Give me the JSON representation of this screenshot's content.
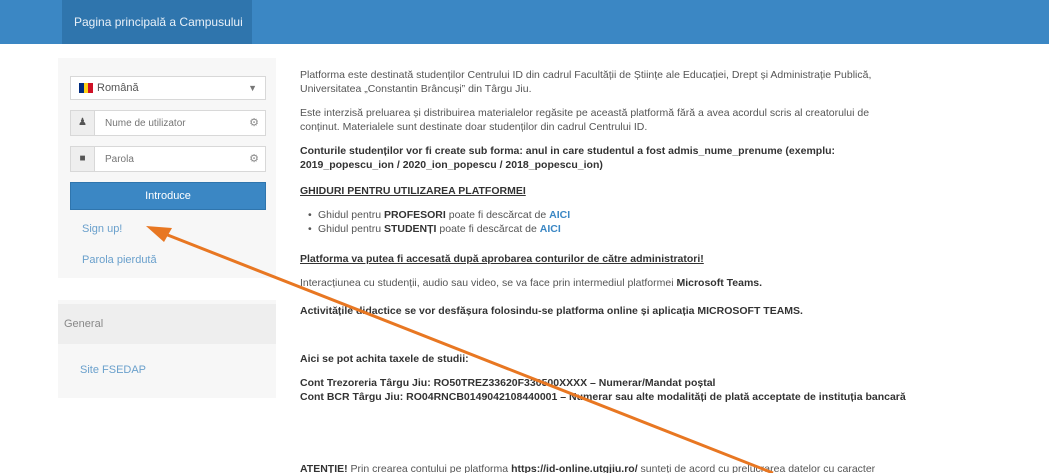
{
  "header": {
    "home_tab": "Pagina principală a Campusului"
  },
  "login": {
    "language": "Română",
    "username_placeholder": "Nume de utilizator",
    "password_placeholder": "Parola",
    "submit_label": "Introduce",
    "signup_label": "Sign up!",
    "lost_password_label": "Parola pierdută"
  },
  "sidebar": {
    "section_title": "General",
    "link_label": "Site FSEDAP"
  },
  "content": {
    "intro_1": "Platforma este destinată studenților Centrului ID din cadrul Facultății de Științe ale Educației, Drept și Administrație Publică,",
    "intro_2": "Universitatea „Constantin Brâncuși” din Târgu Jiu.",
    "copy_1": "Este interzisă preluarea și distribuirea materialelor regăsite pe această platformă fără a avea acordul scris al creatorului de",
    "copy_2": "conținut. Materialele sunt destinate doar studenților din cadrul Centrului ID.",
    "accounts_1": "Conturile studenților vor fi create sub forma: anul in care studentul a fost admis_nume_prenume (exemplu:",
    "accounts_2": "2019_popescu_ion / 2020_ion_popescu / 2018_popescu_ion)",
    "guides_title": "GHIDURI PENTRU UTILIZAREA PLATFORMEI",
    "guide_prof_prefix": "Ghidul pentru ",
    "guide_prof_bold": "PROFESORI",
    "guide_prof_suffix": " poate fi descărcat de ",
    "guide_stud_prefix": "Ghidul pentru ",
    "guide_stud_bold": "STUDENȚI",
    "guide_stud_suffix": " poate fi descărcat de ",
    "here": "AICI",
    "access_note": "Platforma va putea fi accesată după aprobarea conturilor de către administratori!",
    "teams_prefix": "Interacțiunea cu studenții, audio sau video, se va face prin intermediul platformei ",
    "teams_bold": "Microsoft Teams.",
    "activities": "Activitățile didactice se vor desfășura folosindu-se platforma online și aplicația MICROSOFT TEAMS.",
    "fees_title": "Aici se pot achita taxele de studii:",
    "treasury": "Cont Trezoreria Târgu Jiu: RO50TREZ33620F330500XXXX – Numerar/Mandat poștal",
    "bcr": "Cont BCR Târgu Jiu: RO04RNCB0149042108440001 – Numerar sau alte modalități de plată acceptate de instituția bancară",
    "attention_bold": "ATENȚIE!",
    "attention_text": " Prin crearea contului pe platforma ",
    "attention_url": "https://id-online.utgjiu.ro/",
    "attention_tail": " sunteți de acord cu prelucrarea datelor cu caracter"
  },
  "colors": {
    "header": "#3b87c4",
    "header_tab": "#2f75ad",
    "link": "#6aa0cc",
    "arrow": "#e87722"
  },
  "icons": {
    "user": "user-icon",
    "lock": "lock-icon",
    "key": "key-icon",
    "flag": "romania-flag-icon",
    "caret": "caret-down-icon"
  }
}
